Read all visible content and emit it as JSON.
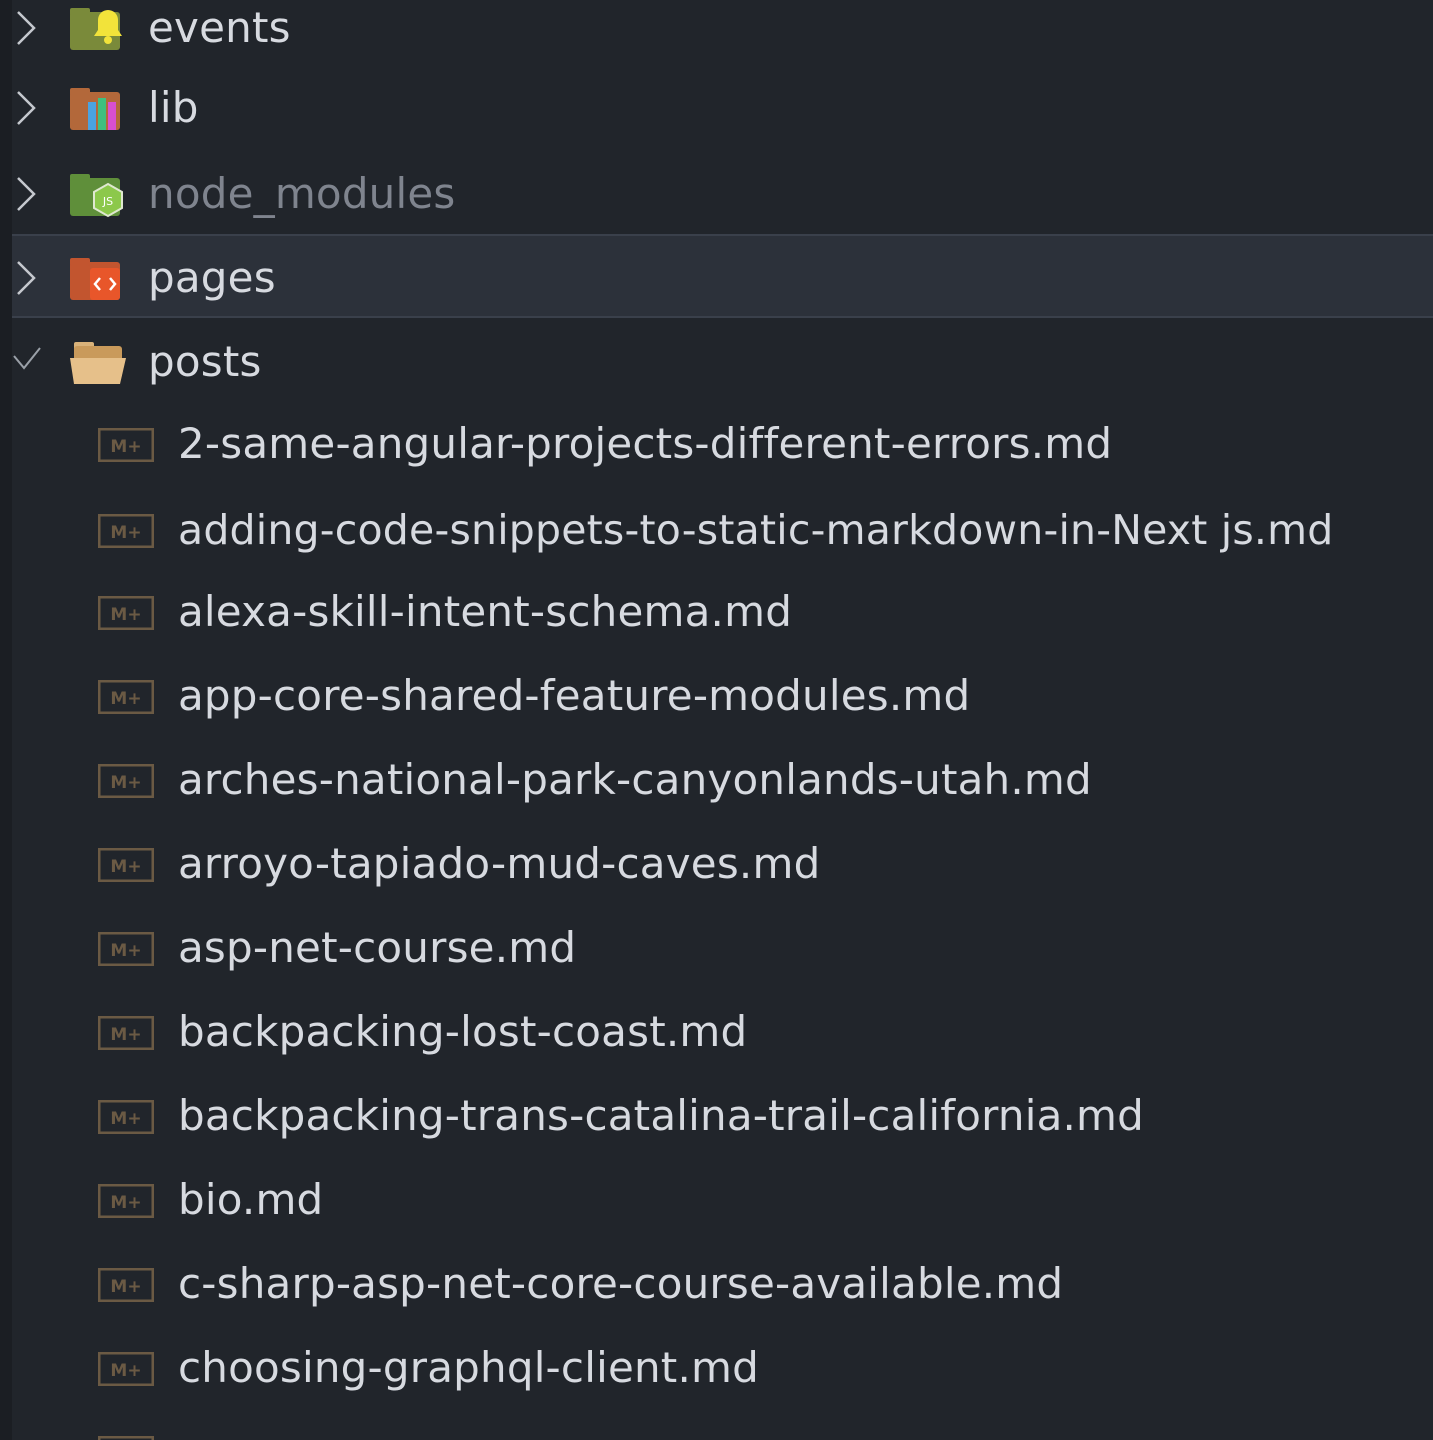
{
  "explorer": {
    "folders": [
      {
        "name": "events",
        "icon": "events-folder-icon",
        "expanded": false,
        "dimmed": false,
        "selected": false
      },
      {
        "name": "lib",
        "icon": "lib-folder-icon",
        "expanded": false,
        "dimmed": false,
        "selected": false
      },
      {
        "name": "node_modules",
        "icon": "node-modules-folder-icon",
        "expanded": false,
        "dimmed": true,
        "selected": false
      },
      {
        "name": "pages",
        "icon": "pages-folder-icon",
        "expanded": false,
        "dimmed": false,
        "selected": true
      },
      {
        "name": "posts",
        "icon": "open-folder-icon",
        "expanded": true,
        "dimmed": false,
        "selected": false
      }
    ],
    "files": [
      "2-same-angular-projects-different-errors.md",
      "adding-code-snippets-to-static-markdown-in-Next js.md",
      "alexa-skill-intent-schema.md",
      "app-core-shared-feature-modules.md",
      "arches-national-park-canyonlands-utah.md",
      "arroyo-tapiado-mud-caves.md",
      "asp-net-course.md",
      "backpacking-lost-coast.md",
      "backpacking-trans-catalina-trail-california.md",
      "bio.md",
      "c-sharp-asp-net-core-course-available.md",
      "choosing-graphql-client.md"
    ],
    "file_icon": "markdown-icon",
    "file_icon_text": "M+",
    "colors": {
      "background": "#21252b",
      "selected_row": "#2c313a",
      "text": "#d7dae0",
      "dim_text": "#7f848e"
    }
  }
}
